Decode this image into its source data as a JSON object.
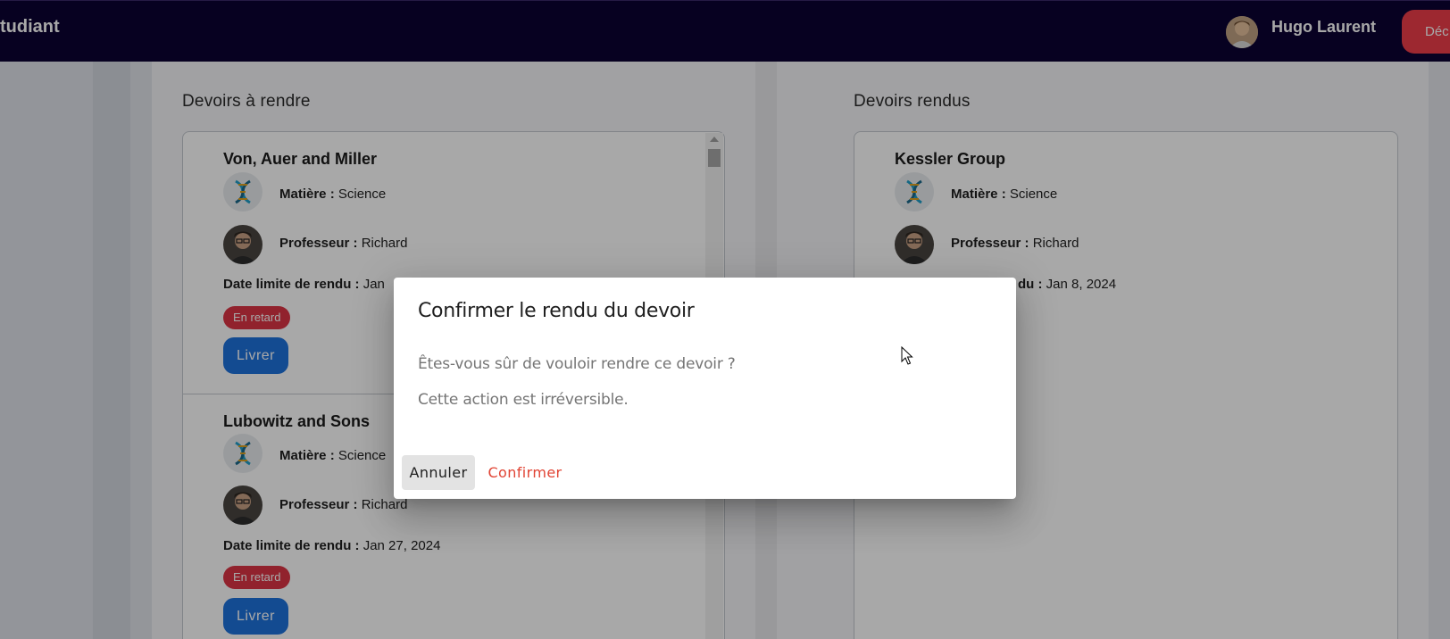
{
  "navbar": {
    "brand": "tudiant",
    "user_name": "Hugo Laurent",
    "logout_label": "Déc",
    "avatar_icon": "user-avatar-icon"
  },
  "pending": {
    "title": "Devoirs à rendre",
    "cards": [
      {
        "title": "Von, Auer and Miller",
        "subject_label": "Matière :",
        "subject": "Science",
        "teacher_label": "Professeur :",
        "teacher": "Richard",
        "due_label": "Date limite de rendu :",
        "due": "Jan",
        "badge": "En retard",
        "button": "Livrer"
      },
      {
        "title": "Lubowitz and Sons",
        "subject_label": "Matière :",
        "subject": "Science",
        "teacher_label": "Professeur :",
        "teacher": "Richard",
        "due_label": "Date limite de rendu :",
        "due": "Jan 27, 2024",
        "badge": "En retard",
        "button": "Livrer"
      }
    ]
  },
  "submitted": {
    "title": "Devoirs rendus",
    "cards": [
      {
        "title": "Kessler Group",
        "subject_label": "Matière :",
        "subject": "Science",
        "teacher_label": "Professeur :",
        "teacher": "Richard",
        "due_label_partial": "du :",
        "due": "Jan 8, 2024"
      }
    ]
  },
  "dialog": {
    "title": "Confirmer le rendu du devoir",
    "line1": "Êtes-vous sûr de vouloir rendre ce devoir ?",
    "line2": "Cette action est irréversible.",
    "cancel": "Annuler",
    "confirm": "Confirmer"
  },
  "colors": {
    "navbar": "#0b0333",
    "logout": "#ef3d4a",
    "late_badge": "#dc3545",
    "deliver_button": "#1e72dc",
    "confirm_text": "#e14434"
  }
}
